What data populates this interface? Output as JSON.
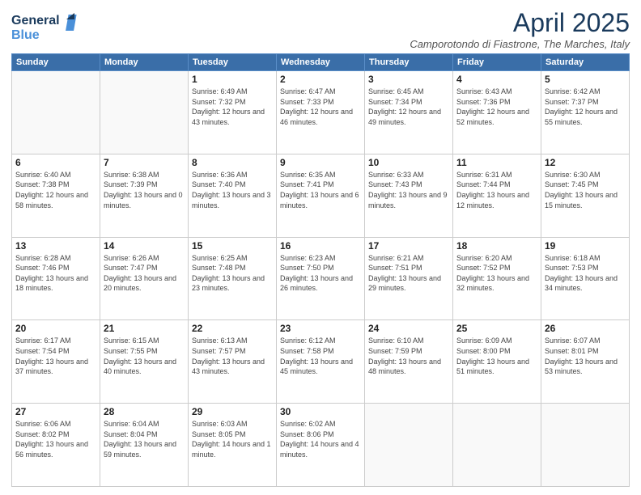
{
  "logo": {
    "line1": "General",
    "line2": "Blue"
  },
  "title": "April 2025",
  "subtitle": "Camporotondo di Fiastrone, The Marches, Italy",
  "days_header": [
    "Sunday",
    "Monday",
    "Tuesday",
    "Wednesday",
    "Thursday",
    "Friday",
    "Saturday"
  ],
  "weeks": [
    [
      {
        "day": "",
        "info": ""
      },
      {
        "day": "",
        "info": ""
      },
      {
        "day": "1",
        "info": "Sunrise: 6:49 AM\nSunset: 7:32 PM\nDaylight: 12 hours and 43 minutes."
      },
      {
        "day": "2",
        "info": "Sunrise: 6:47 AM\nSunset: 7:33 PM\nDaylight: 12 hours and 46 minutes."
      },
      {
        "day": "3",
        "info": "Sunrise: 6:45 AM\nSunset: 7:34 PM\nDaylight: 12 hours and 49 minutes."
      },
      {
        "day": "4",
        "info": "Sunrise: 6:43 AM\nSunset: 7:36 PM\nDaylight: 12 hours and 52 minutes."
      },
      {
        "day": "5",
        "info": "Sunrise: 6:42 AM\nSunset: 7:37 PM\nDaylight: 12 hours and 55 minutes."
      }
    ],
    [
      {
        "day": "6",
        "info": "Sunrise: 6:40 AM\nSunset: 7:38 PM\nDaylight: 12 hours and 58 minutes."
      },
      {
        "day": "7",
        "info": "Sunrise: 6:38 AM\nSunset: 7:39 PM\nDaylight: 13 hours and 0 minutes."
      },
      {
        "day": "8",
        "info": "Sunrise: 6:36 AM\nSunset: 7:40 PM\nDaylight: 13 hours and 3 minutes."
      },
      {
        "day": "9",
        "info": "Sunrise: 6:35 AM\nSunset: 7:41 PM\nDaylight: 13 hours and 6 minutes."
      },
      {
        "day": "10",
        "info": "Sunrise: 6:33 AM\nSunset: 7:43 PM\nDaylight: 13 hours and 9 minutes."
      },
      {
        "day": "11",
        "info": "Sunrise: 6:31 AM\nSunset: 7:44 PM\nDaylight: 13 hours and 12 minutes."
      },
      {
        "day": "12",
        "info": "Sunrise: 6:30 AM\nSunset: 7:45 PM\nDaylight: 13 hours and 15 minutes."
      }
    ],
    [
      {
        "day": "13",
        "info": "Sunrise: 6:28 AM\nSunset: 7:46 PM\nDaylight: 13 hours and 18 minutes."
      },
      {
        "day": "14",
        "info": "Sunrise: 6:26 AM\nSunset: 7:47 PM\nDaylight: 13 hours and 20 minutes."
      },
      {
        "day": "15",
        "info": "Sunrise: 6:25 AM\nSunset: 7:48 PM\nDaylight: 13 hours and 23 minutes."
      },
      {
        "day": "16",
        "info": "Sunrise: 6:23 AM\nSunset: 7:50 PM\nDaylight: 13 hours and 26 minutes."
      },
      {
        "day": "17",
        "info": "Sunrise: 6:21 AM\nSunset: 7:51 PM\nDaylight: 13 hours and 29 minutes."
      },
      {
        "day": "18",
        "info": "Sunrise: 6:20 AM\nSunset: 7:52 PM\nDaylight: 13 hours and 32 minutes."
      },
      {
        "day": "19",
        "info": "Sunrise: 6:18 AM\nSunset: 7:53 PM\nDaylight: 13 hours and 34 minutes."
      }
    ],
    [
      {
        "day": "20",
        "info": "Sunrise: 6:17 AM\nSunset: 7:54 PM\nDaylight: 13 hours and 37 minutes."
      },
      {
        "day": "21",
        "info": "Sunrise: 6:15 AM\nSunset: 7:55 PM\nDaylight: 13 hours and 40 minutes."
      },
      {
        "day": "22",
        "info": "Sunrise: 6:13 AM\nSunset: 7:57 PM\nDaylight: 13 hours and 43 minutes."
      },
      {
        "day": "23",
        "info": "Sunrise: 6:12 AM\nSunset: 7:58 PM\nDaylight: 13 hours and 45 minutes."
      },
      {
        "day": "24",
        "info": "Sunrise: 6:10 AM\nSunset: 7:59 PM\nDaylight: 13 hours and 48 minutes."
      },
      {
        "day": "25",
        "info": "Sunrise: 6:09 AM\nSunset: 8:00 PM\nDaylight: 13 hours and 51 minutes."
      },
      {
        "day": "26",
        "info": "Sunrise: 6:07 AM\nSunset: 8:01 PM\nDaylight: 13 hours and 53 minutes."
      }
    ],
    [
      {
        "day": "27",
        "info": "Sunrise: 6:06 AM\nSunset: 8:02 PM\nDaylight: 13 hours and 56 minutes."
      },
      {
        "day": "28",
        "info": "Sunrise: 6:04 AM\nSunset: 8:04 PM\nDaylight: 13 hours and 59 minutes."
      },
      {
        "day": "29",
        "info": "Sunrise: 6:03 AM\nSunset: 8:05 PM\nDaylight: 14 hours and 1 minute."
      },
      {
        "day": "30",
        "info": "Sunrise: 6:02 AM\nSunset: 8:06 PM\nDaylight: 14 hours and 4 minutes."
      },
      {
        "day": "",
        "info": ""
      },
      {
        "day": "",
        "info": ""
      },
      {
        "day": "",
        "info": ""
      }
    ]
  ]
}
